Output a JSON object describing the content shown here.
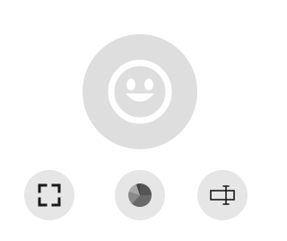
{
  "colors": {
    "avatar_bg": "#dedede",
    "avatar_face": "#ffffff",
    "button_bg": "#e6e6e6",
    "icon_stroke": "#1a1a1a",
    "pie_dark": "#555555",
    "pie_light": "#a8a8a8"
  },
  "avatar": {
    "icon": "smiley-face-icon"
  },
  "toolbar": {
    "buttons": [
      {
        "icon": "fullscreen-corners-icon"
      },
      {
        "icon": "pie-chart-icon"
      },
      {
        "icon": "text-cursor-box-icon"
      }
    ]
  }
}
